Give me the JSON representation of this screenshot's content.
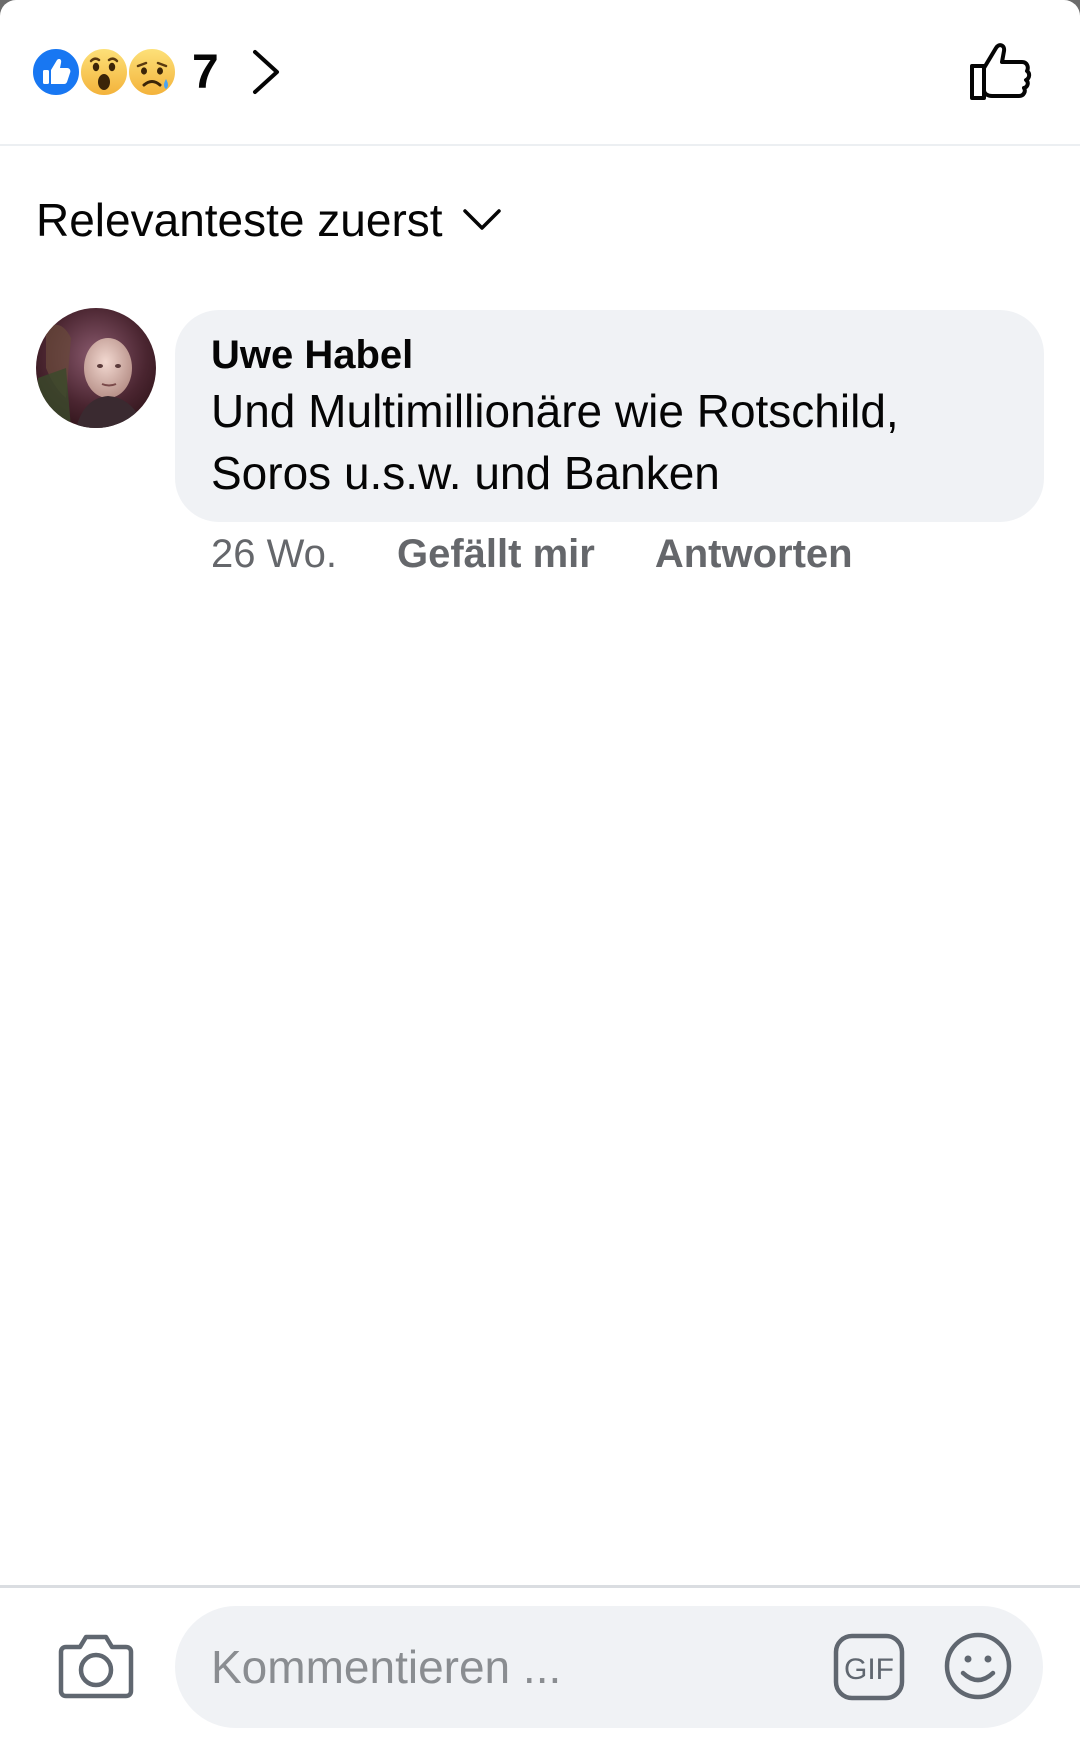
{
  "reactions": {
    "icons": [
      "like-reaction-icon",
      "wow-reaction-icon",
      "sad-reaction-icon"
    ],
    "count": "7"
  },
  "sort": {
    "label": "Relevanteste zuerst"
  },
  "comment": {
    "author": "Uwe Habel",
    "text_line1": "Und Multimillionäre wie Rotschild,",
    "text_line2": "Soros u.s.w. und Banken",
    "time": "26 Wo.",
    "like_label": "Gefällt mir",
    "reply_label": "Antworten"
  },
  "composer": {
    "placeholder": "Kommentieren ...",
    "gif_label": "GIF"
  },
  "colors": {
    "accent_blue": "#1877f2",
    "bubble_bg": "#f0f2f5",
    "secondary_text": "#65676b",
    "primary_text": "#050505"
  }
}
